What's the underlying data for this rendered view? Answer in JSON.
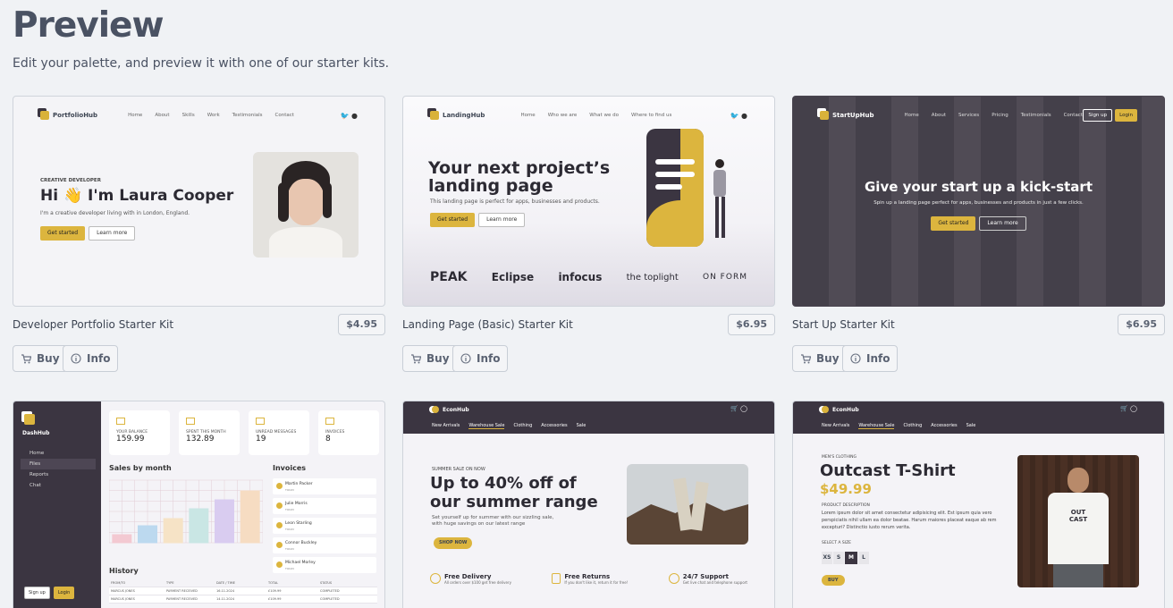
{
  "header": {
    "title": "Preview",
    "subtitle": "Edit your palette, and preview it with one of our starter kits."
  },
  "common": {
    "buy": "Buy",
    "info": "Info"
  },
  "kits": [
    {
      "title": "Developer Portfolio Starter Kit",
      "price": "$4.95"
    },
    {
      "title": "Landing Page (Basic) Starter Kit",
      "price": "$6.95"
    },
    {
      "title": "Start Up Starter Kit",
      "price": "$6.95"
    }
  ],
  "portfolio": {
    "logo": "PortfolioHub",
    "nav": [
      "Home",
      "About",
      "Skills",
      "Work",
      "Testimonials",
      "Contact"
    ],
    "eyebrow": "CREATIVE DEVELOPER",
    "headline": "Hi 👋 I'm Laura Cooper",
    "body": "I'm a creative developer living with in London, England.",
    "cta1": "Get started",
    "cta2": "Learn more"
  },
  "landing": {
    "logo": "LandingHub",
    "nav": [
      "Home",
      "Who we are",
      "What we do",
      "Where to find us"
    ],
    "headline1": "Your next project’s",
    "headline2": "landing page",
    "body": "This landing page is perfect for apps, businesses and products.",
    "cta1": "Get started",
    "cta2": "Learn more",
    "brands": [
      "PEAK",
      "Eclipse",
      "infocus",
      "the toplight",
      "ON FORM"
    ]
  },
  "startup": {
    "logo": "StartUpHub",
    "nav": [
      "Home",
      "About",
      "Services",
      "Pricing",
      "Testimonials",
      "Contact"
    ],
    "signup": "Sign up",
    "login": "Login",
    "headline": "Give your start up a kick-start",
    "body": "Spin up a landing page perfect for apps, businesses and products in just a few clicks.",
    "cta1": "Get started",
    "cta2": "Learn more"
  },
  "dash": {
    "logo": "DashHub",
    "nav": [
      "Home",
      "Files",
      "Reports",
      "Chat"
    ],
    "signup": "Sign up",
    "login": "Login",
    "stats": [
      {
        "label": "YOUR BALANCE",
        "value": "159.99"
      },
      {
        "label": "SPENT THIS MONTH",
        "value": "132.89"
      },
      {
        "label": "UNREAD MESSAGES",
        "value": "19"
      },
      {
        "label": "INVOICES",
        "value": "8"
      }
    ],
    "sales_title": "Sales by month",
    "invoices_title": "Invoices",
    "history_title": "History",
    "invoices": [
      "Martin Packer",
      "Julie Morris",
      "Leon Starling",
      "Connor Buckley",
      "Michael Morley"
    ],
    "today": "TODAY",
    "history_cols": [
      "FROM/TO",
      "TYPE",
      "DATE / TIME",
      "TOTAL",
      "STATUS"
    ],
    "history_rows": [
      [
        "MARCUS JONES",
        "PAYMENT RECEIVED",
        "16.11.2024",
        "£109.99",
        "COMPLETED"
      ],
      [
        "MARCUS JONES",
        "PAYMENT RECEIVED",
        "14.11.2024",
        "£109.99",
        "COMPLETED"
      ]
    ],
    "chart_data": {
      "type": "bar",
      "values": [
        9,
        19,
        27,
        38,
        48,
        58
      ],
      "ylim": [
        0,
        70
      ]
    },
    "bar_colors": [
      "#f3c9d2",
      "#bcd9ef",
      "#f6e3c6",
      "#c9e6e4",
      "#d9ccf0",
      "#f6dcc2"
    ]
  },
  "econ": {
    "logo": "EconHub",
    "nav": [
      "New Arrivals",
      "Warehouse Sale",
      "Clothing",
      "Accessories",
      "Sale"
    ],
    "eyebrow": "SUMMER SALE ON NOW",
    "headline1": "Up to 40% off of",
    "headline2": "our summer range",
    "body1": "Set yourself up for summer with our sizzling sale,",
    "body2": "with huge savings on our latest range",
    "cta": "SHOP NOW",
    "features": [
      {
        "t": "Free Delivery",
        "d": "All orders over $100 get free delivery"
      },
      {
        "t": "Free Returns",
        "d": "If you don't like it, return it for free!"
      },
      {
        "t": "24/7 Support",
        "d": "Get live chat and telephone support"
      }
    ]
  },
  "product": {
    "logo": "EconHub",
    "nav": [
      "New Arrivals",
      "Warehouse Sale",
      "Clothing",
      "Accessories",
      "Sale"
    ],
    "eyebrow": "MEN'S CLOTHING",
    "name": "Outcast T-Shirt",
    "price": "$49.99",
    "desc_label": "PRODUCT DESCRIPTION",
    "desc": "Lorem ipsum dolor sit amet consectetur adipisicing elit. Est ipsum quia vero perspiciatis nihil ullam ea dolor beatae. Harum maiores placeat eaque ab rem excepturi? Distinctio iusto rerum verita.",
    "size_label": "SELECT A SIZE",
    "sizes": [
      "XS",
      "S",
      "M",
      "L"
    ],
    "selected": "M",
    "cta": "BUY",
    "shirt": "OUT CAST"
  },
  "colors": {
    "accent": "#dcb53e",
    "dark": "#3b3541",
    "bg": "#f0f2f5"
  }
}
